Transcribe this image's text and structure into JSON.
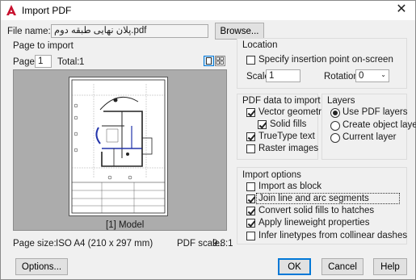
{
  "window": {
    "title": "Import PDF"
  },
  "file": {
    "label": "File name:",
    "value": "پلان نهایی طبقه دوم.pdf",
    "browse_label": "Browse..."
  },
  "page_to_import": {
    "heading": "Page to import",
    "page_label": "Page:",
    "page_value": "1",
    "total_label": "Total:",
    "total_value": "1",
    "preview_caption": "[1] Model",
    "page_size_label": "Page size:",
    "page_size_value": "ISO A4 (210 x 297 mm)",
    "pdf_scale_label": "PDF scale:",
    "pdf_scale_value": "9.8:1"
  },
  "location": {
    "heading": "Location",
    "specify_label": "Specify insertion point on-screen",
    "specify_checked": false,
    "scale_label": "Scale:",
    "scale_value": "1",
    "rotation_label": "Rotation:",
    "rotation_value": "0"
  },
  "pdf_data": {
    "heading": "PDF data to import",
    "items": [
      {
        "label": "Vector geometry",
        "checked": true
      },
      {
        "label": "Solid fills",
        "checked": true
      },
      {
        "label": "TrueType text",
        "checked": true
      },
      {
        "label": "Raster images",
        "checked": false
      }
    ]
  },
  "layers": {
    "heading": "Layers",
    "options": [
      {
        "label": "Use PDF layers",
        "selected": true
      },
      {
        "label": "Create object layers",
        "selected": false
      },
      {
        "label": "Current layer",
        "selected": false
      }
    ]
  },
  "import_options": {
    "heading": "Import options",
    "items": [
      {
        "label": "Import as block",
        "checked": false
      },
      {
        "label": "Join line and arc segments",
        "checked": true
      },
      {
        "label": "Convert solid fills to hatches",
        "checked": true
      },
      {
        "label": "Apply lineweight properties",
        "checked": true
      },
      {
        "label": "Infer linetypes from collinear dashes",
        "checked": false
      }
    ]
  },
  "buttons": {
    "options": "Options...",
    "ok": "OK",
    "cancel": "Cancel",
    "help": "Help"
  },
  "colors": {
    "accent": "#0078d7",
    "preview_bg": "#acacac",
    "title_icon": "#c8102e"
  }
}
